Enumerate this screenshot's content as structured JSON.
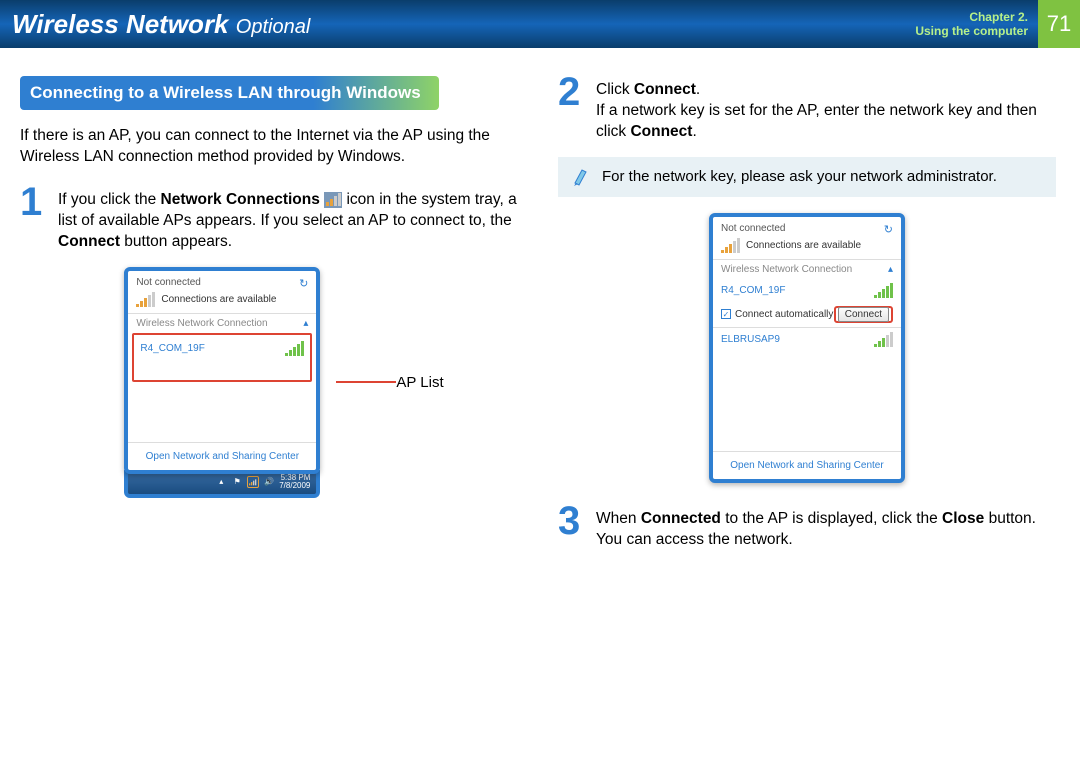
{
  "header": {
    "title_main": "Wireless Network",
    "title_suffix": "Optional",
    "chapter_line": "Chapter 2.",
    "section_line": "Using the computer",
    "page_number": "71"
  },
  "left": {
    "banner": "Connecting to a Wireless LAN through Windows",
    "intro": "If there is an AP, you can connect to the Internet via the AP using the Wireless LAN connection method provided by Windows.",
    "step1_num": "1",
    "step1_a": "If you click the ",
    "step1_b": "Network Connections",
    "step1_c": " icon in the system tray, a list of available APs appears. If you select an AP to connect to, the ",
    "step1_d": "Connect",
    "step1_e": " button appears.",
    "callout_label": "AP List"
  },
  "right": {
    "step2_num": "2",
    "step2_line1_a": "Click ",
    "step2_line1_b": "Connect",
    "step2_line1_c": ".",
    "step2_line2_a": "If a network key is set for the AP, enter the network key and then click ",
    "step2_line2_b": "Connect",
    "step2_line2_c": ".",
    "note": "For the network key, please ask your network administrator.",
    "step3_num": "3",
    "step3_a": "When ",
    "step3_b": "Connected",
    "step3_c": " to the AP is displayed, click the ",
    "step3_d": "Close",
    "step3_e": " button.",
    "step3_f": "You can access the network."
  },
  "popup": {
    "not_connected": "Not connected",
    "avail": "Connections are available",
    "wireless_title": "Wireless Network Connection",
    "ap1": "R4_COM_19F",
    "ap2": "ELBRUSAP9",
    "auto": "Connect automatically",
    "connect_btn": "Connect",
    "footer": "Open Network and Sharing Center",
    "clock_time": "5:38 PM",
    "clock_date": "7/8/2009"
  }
}
